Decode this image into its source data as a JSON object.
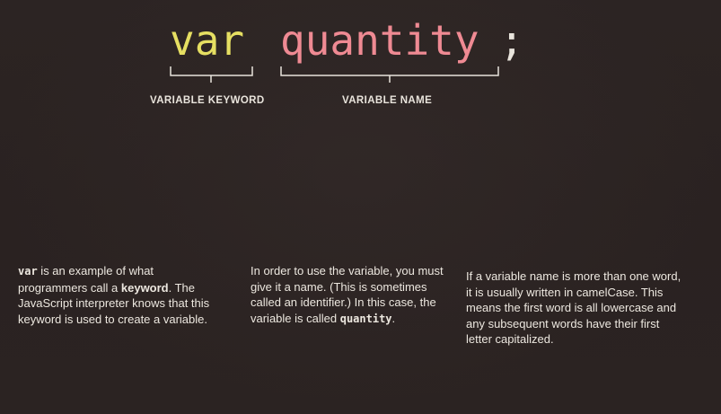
{
  "code": {
    "keyword": "var",
    "name": "quantity",
    "semicolon": ";"
  },
  "labels": {
    "keyword": "VARIABLE KEYWORD",
    "name": "VARIABLE NAME"
  },
  "colors": {
    "keyword": "#e6df62",
    "name": "#ef8a93",
    "text": "#ece7df",
    "background": "#2a2322"
  },
  "paragraphs": {
    "p1": {
      "code": "var",
      "text_a": " is an example of what programmers call a ",
      "bold": "keyword",
      "text_b": ". The JavaScript interpreter knows that this keyword is used to create a variable."
    },
    "p2": {
      "text_a": "In order to use the variable, you must give it a name. (This is sometimes called an identifier.) In this case, the variable is called ",
      "code": "quantity",
      "text_b": "."
    },
    "p3": {
      "text": "If a variable name is more than one word, it is usually written in camelCase. This means the first word is all lowercase and any subsequent words have their first letter capitalized."
    }
  }
}
